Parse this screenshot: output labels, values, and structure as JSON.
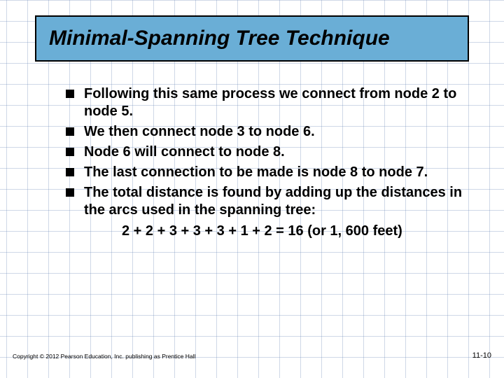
{
  "title": "Minimal-Spanning Tree Technique",
  "bullets": {
    "b1": "Following this same process we connect from node 2 to node 5.",
    "b2": "We then connect node 3 to node 6.",
    "b3": "Node 6 will connect to node 8.",
    "b4": "The last connection to be made is node 8 to node 7.",
    "b5": "The total distance is found by adding up the distances in the arcs used in the spanning tree:"
  },
  "equation": "2 + 2 + 3 + 3 + 3 + 1 + 2 = 16 (or 1, 600 feet)",
  "footer": {
    "copyright": "Copyright © 2012 Pearson Education, Inc. publishing as Prentice Hall",
    "page": "11-10"
  }
}
